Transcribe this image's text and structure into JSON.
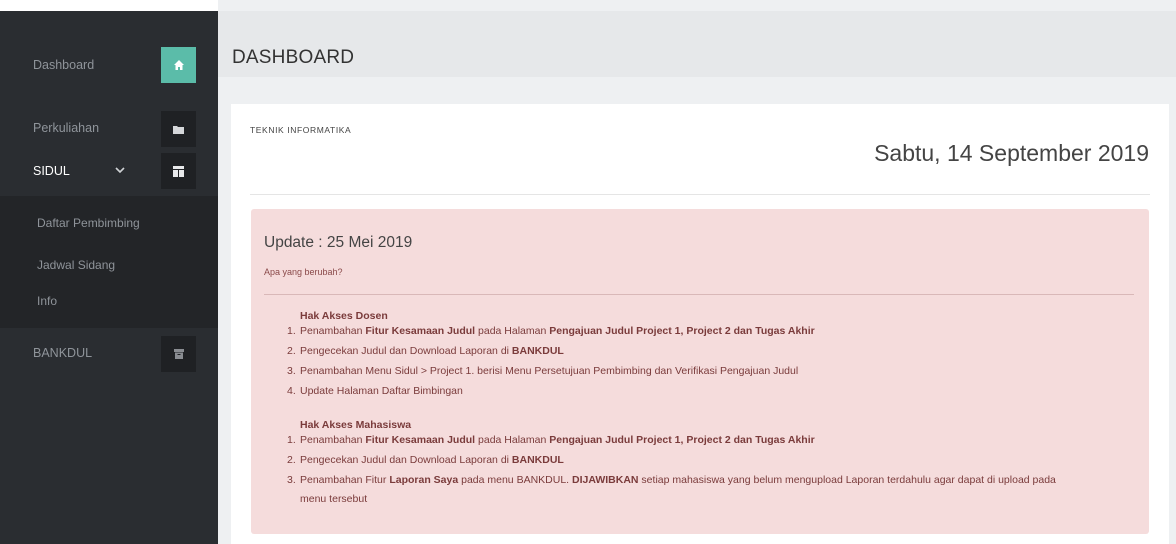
{
  "sidebar": {
    "items": [
      {
        "label": "Dashboard",
        "icon": "home-icon",
        "active": true
      },
      {
        "label": "Perkuliahan",
        "icon": "folder-icon"
      },
      {
        "label": "SIDUL",
        "icon": "layout-icon",
        "expanded": true
      },
      {
        "label": "BANKDUL",
        "icon": "archive-icon"
      }
    ],
    "submenu": [
      {
        "label": "Daftar Pembimbing"
      },
      {
        "label": "Jadwal Sidang"
      },
      {
        "label": "Info"
      }
    ]
  },
  "header": {
    "title": "DASHBOARD"
  },
  "card": {
    "department": "TEKNIK INFORMATIKA",
    "date": "Sabtu, 14 September 2019"
  },
  "update": {
    "title": "Update : 25 Mei 2019",
    "subtitle": "Apa yang berubah?",
    "dosen": {
      "heading": "Hak Akses Dosen",
      "items": [
        {
          "n": "1.",
          "a": "Penambahan ",
          "b1": "Fitur Kesamaan Judul",
          "c": " pada Halaman ",
          "b2": "Pengajuan Judul Project 1, Project 2 dan Tugas Akhir"
        },
        {
          "n": "2.",
          "a": "Pengecekan Judul dan Download Laporan di ",
          "b1": "BANKDUL"
        },
        {
          "n": "3.",
          "a": "Penambahan Menu Sidul > Project 1. berisi Menu Persetujuan Pembimbing dan Verifikasi Pengajuan Judul"
        },
        {
          "n": "4.",
          "a": "Update Halaman Daftar Bimbingan"
        }
      ]
    },
    "mahasiswa": {
      "heading": "Hak Akses Mahasiswa",
      "items": [
        {
          "n": "1.",
          "a": "Penambahan ",
          "b1": "Fitur Kesamaan Judul",
          "c": " pada Halaman ",
          "b2": "Pengajuan Judul Project 1, Project 2 dan Tugas Akhir"
        },
        {
          "n": "2.",
          "a": "Pengecekan Judul dan Download Laporan di ",
          "b1": "BANKDUL"
        },
        {
          "n": "3.",
          "a": "Penambahan Fitur ",
          "b1": "Laporan Saya",
          "c": " pada menu BANKDUL. ",
          "b2": "DIJAWIBKAN",
          "d": " setiap mahasiswa yang belum mengupload Laporan terdahulu agar dapat di upload pada",
          "e": "menu tersebut"
        }
      ]
    }
  },
  "colors": {
    "sidebar": "#2a2d31",
    "accent": "#5bbca9",
    "alert_bg": "#f5dcdc",
    "alert_text": "#7a3b3b"
  }
}
